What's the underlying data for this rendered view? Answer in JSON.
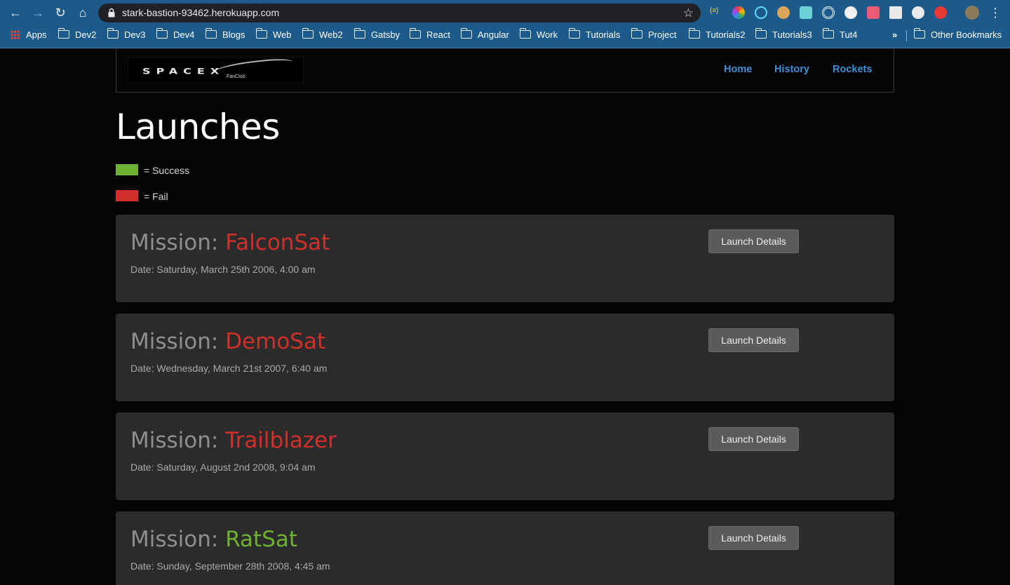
{
  "browser": {
    "url": "stark-bastion-93462.herokuapp.com",
    "bookmarks": [
      "Apps",
      "Dev2",
      "Dev3",
      "Dev4",
      "Blogs",
      "Web",
      "Web2",
      "Gatsby",
      "React",
      "Angular",
      "Work",
      "Tutorials",
      "Project",
      "Tutorials2",
      "Tutorials3",
      "Tut4"
    ],
    "overflow": "»",
    "other_bookmarks": "Other Bookmarks",
    "extension_badge": "{≡}"
  },
  "site": {
    "logo_text": "SPACEX",
    "logo_sub": "FanClub",
    "nav": [
      "Home",
      "History",
      "Rockets"
    ]
  },
  "page": {
    "title": "Launches",
    "legend": [
      {
        "label": "= Success",
        "color": "#6fb132"
      },
      {
        "label": "= Fail",
        "color": "#d12f2a"
      }
    ],
    "mission_prefix": "Mission: ",
    "details_label": "Launch Details",
    "launches": [
      {
        "name": "FalconSat",
        "date": "Date: Saturday, March 25th 2006, 4:00 am",
        "success": false
      },
      {
        "name": "DemoSat",
        "date": "Date: Wednesday, March 21st 2007, 6:40 am",
        "success": false
      },
      {
        "name": "Trailblazer",
        "date": "Date: Saturday, August 2nd 2008, 9:04 am",
        "success": false
      },
      {
        "name": "RatSat",
        "date": "Date: Sunday, September 28th 2008, 4:45 am",
        "success": true
      }
    ]
  }
}
